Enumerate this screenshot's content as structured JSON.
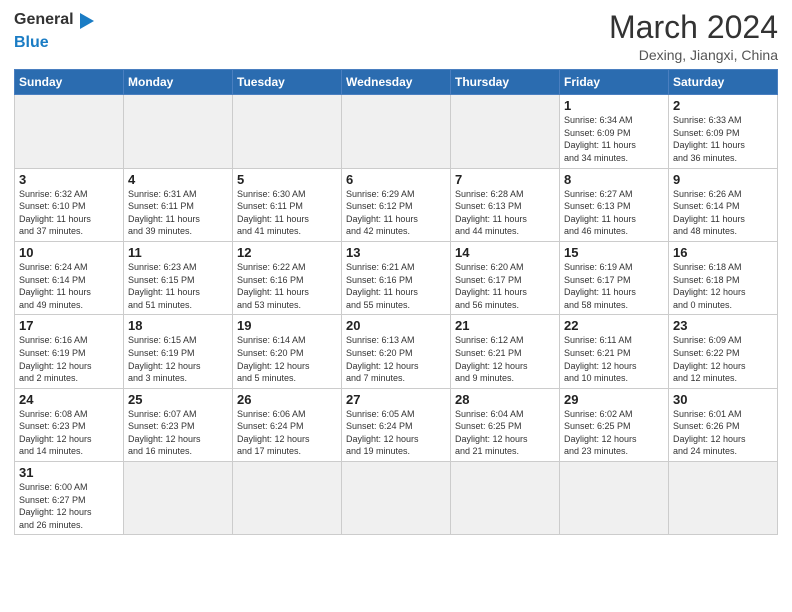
{
  "header": {
    "logo_general": "General",
    "logo_blue": "Blue",
    "title": "March 2024",
    "subtitle": "Dexing, Jiangxi, China"
  },
  "weekdays": [
    "Sunday",
    "Monday",
    "Tuesday",
    "Wednesday",
    "Thursday",
    "Friday",
    "Saturday"
  ],
  "weeks": [
    [
      {
        "day": "",
        "info": "",
        "empty": true
      },
      {
        "day": "",
        "info": "",
        "empty": true
      },
      {
        "day": "",
        "info": "",
        "empty": true
      },
      {
        "day": "",
        "info": "",
        "empty": true
      },
      {
        "day": "",
        "info": "",
        "empty": true
      },
      {
        "day": "1",
        "info": "Sunrise: 6:34 AM\nSunset: 6:09 PM\nDaylight: 11 hours\nand 34 minutes."
      },
      {
        "day": "2",
        "info": "Sunrise: 6:33 AM\nSunset: 6:09 PM\nDaylight: 11 hours\nand 36 minutes."
      }
    ],
    [
      {
        "day": "3",
        "info": "Sunrise: 6:32 AM\nSunset: 6:10 PM\nDaylight: 11 hours\nand 37 minutes."
      },
      {
        "day": "4",
        "info": "Sunrise: 6:31 AM\nSunset: 6:11 PM\nDaylight: 11 hours\nand 39 minutes."
      },
      {
        "day": "5",
        "info": "Sunrise: 6:30 AM\nSunset: 6:11 PM\nDaylight: 11 hours\nand 41 minutes."
      },
      {
        "day": "6",
        "info": "Sunrise: 6:29 AM\nSunset: 6:12 PM\nDaylight: 11 hours\nand 42 minutes."
      },
      {
        "day": "7",
        "info": "Sunrise: 6:28 AM\nSunset: 6:13 PM\nDaylight: 11 hours\nand 44 minutes."
      },
      {
        "day": "8",
        "info": "Sunrise: 6:27 AM\nSunset: 6:13 PM\nDaylight: 11 hours\nand 46 minutes."
      },
      {
        "day": "9",
        "info": "Sunrise: 6:26 AM\nSunset: 6:14 PM\nDaylight: 11 hours\nand 48 minutes."
      }
    ],
    [
      {
        "day": "10",
        "info": "Sunrise: 6:24 AM\nSunset: 6:14 PM\nDaylight: 11 hours\nand 49 minutes."
      },
      {
        "day": "11",
        "info": "Sunrise: 6:23 AM\nSunset: 6:15 PM\nDaylight: 11 hours\nand 51 minutes."
      },
      {
        "day": "12",
        "info": "Sunrise: 6:22 AM\nSunset: 6:16 PM\nDaylight: 11 hours\nand 53 minutes."
      },
      {
        "day": "13",
        "info": "Sunrise: 6:21 AM\nSunset: 6:16 PM\nDaylight: 11 hours\nand 55 minutes."
      },
      {
        "day": "14",
        "info": "Sunrise: 6:20 AM\nSunset: 6:17 PM\nDaylight: 11 hours\nand 56 minutes."
      },
      {
        "day": "15",
        "info": "Sunrise: 6:19 AM\nSunset: 6:17 PM\nDaylight: 11 hours\nand 58 minutes."
      },
      {
        "day": "16",
        "info": "Sunrise: 6:18 AM\nSunset: 6:18 PM\nDaylight: 12 hours\nand 0 minutes."
      }
    ],
    [
      {
        "day": "17",
        "info": "Sunrise: 6:16 AM\nSunset: 6:19 PM\nDaylight: 12 hours\nand 2 minutes."
      },
      {
        "day": "18",
        "info": "Sunrise: 6:15 AM\nSunset: 6:19 PM\nDaylight: 12 hours\nand 3 minutes."
      },
      {
        "day": "19",
        "info": "Sunrise: 6:14 AM\nSunset: 6:20 PM\nDaylight: 12 hours\nand 5 minutes."
      },
      {
        "day": "20",
        "info": "Sunrise: 6:13 AM\nSunset: 6:20 PM\nDaylight: 12 hours\nand 7 minutes."
      },
      {
        "day": "21",
        "info": "Sunrise: 6:12 AM\nSunset: 6:21 PM\nDaylight: 12 hours\nand 9 minutes."
      },
      {
        "day": "22",
        "info": "Sunrise: 6:11 AM\nSunset: 6:21 PM\nDaylight: 12 hours\nand 10 minutes."
      },
      {
        "day": "23",
        "info": "Sunrise: 6:09 AM\nSunset: 6:22 PM\nDaylight: 12 hours\nand 12 minutes."
      }
    ],
    [
      {
        "day": "24",
        "info": "Sunrise: 6:08 AM\nSunset: 6:23 PM\nDaylight: 12 hours\nand 14 minutes."
      },
      {
        "day": "25",
        "info": "Sunrise: 6:07 AM\nSunset: 6:23 PM\nDaylight: 12 hours\nand 16 minutes."
      },
      {
        "day": "26",
        "info": "Sunrise: 6:06 AM\nSunset: 6:24 PM\nDaylight: 12 hours\nand 17 minutes."
      },
      {
        "day": "27",
        "info": "Sunrise: 6:05 AM\nSunset: 6:24 PM\nDaylight: 12 hours\nand 19 minutes."
      },
      {
        "day": "28",
        "info": "Sunrise: 6:04 AM\nSunset: 6:25 PM\nDaylight: 12 hours\nand 21 minutes."
      },
      {
        "day": "29",
        "info": "Sunrise: 6:02 AM\nSunset: 6:25 PM\nDaylight: 12 hours\nand 23 minutes."
      },
      {
        "day": "30",
        "info": "Sunrise: 6:01 AM\nSunset: 6:26 PM\nDaylight: 12 hours\nand 24 minutes."
      }
    ],
    [
      {
        "day": "31",
        "info": "Sunrise: 6:00 AM\nSunset: 6:27 PM\nDaylight: 12 hours\nand 26 minutes."
      },
      {
        "day": "",
        "info": "",
        "empty": true
      },
      {
        "day": "",
        "info": "",
        "empty": true
      },
      {
        "day": "",
        "info": "",
        "empty": true
      },
      {
        "day": "",
        "info": "",
        "empty": true
      },
      {
        "day": "",
        "info": "",
        "empty": true
      },
      {
        "day": "",
        "info": "",
        "empty": true
      }
    ]
  ]
}
